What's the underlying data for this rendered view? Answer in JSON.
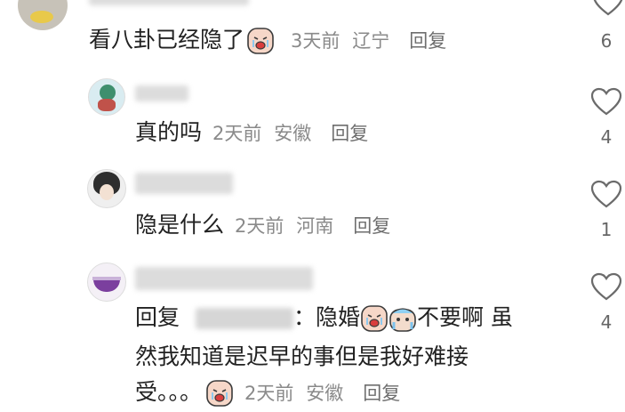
{
  "comments": [
    {
      "text": "看八卦已经隐了",
      "time": "3天前",
      "location": "辽宁",
      "reply_label": "回复",
      "likes": "6"
    },
    {
      "text": "真的吗",
      "time": "2天前",
      "location": "安徽",
      "reply_label": "回复",
      "likes": "4"
    },
    {
      "text": "隐是什么",
      "time": "2天前",
      "location": "河南",
      "reply_label": "回复",
      "likes": "1"
    },
    {
      "reply_prefix": "回复",
      "colon": "：",
      "text_part1": "隐婚",
      "text_part2": "不要啊 虽",
      "text_line2": "然我知道是迟早的事但是我好难接",
      "text_line3": "受。。。",
      "time": "2天前",
      "location": "安徽",
      "reply_label": "回复",
      "likes": "4"
    }
  ],
  "colors": {
    "meta": "#8a8a8a",
    "heart_stroke": "#6b6b6b",
    "blur": "#dcdcdc"
  },
  "icons": [
    "heart-outline-icon",
    "crying-face-emoji",
    "sweating-face-emoji"
  ]
}
